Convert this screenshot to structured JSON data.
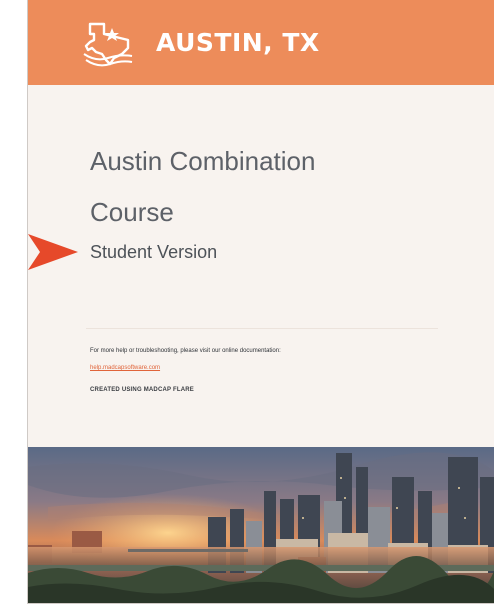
{
  "banner": {
    "title": "AUSTIN, TX",
    "logo_icon": "texas-state-star-icon",
    "background": "#ed8c5a"
  },
  "cover": {
    "title_line1": "Austin Combination",
    "title_line2": "Course",
    "subtitle": "Student Version"
  },
  "footer": {
    "help_text": "For more help or troubleshooting, please visit our online documentation:",
    "link": "help.madcapsoftware.com",
    "created": "CREATED USING MADCAP FLARE"
  },
  "accent": "#e0643a",
  "marker_icon": "pointer-arrow-icon",
  "photo": "austin-skyline-sunset-image"
}
